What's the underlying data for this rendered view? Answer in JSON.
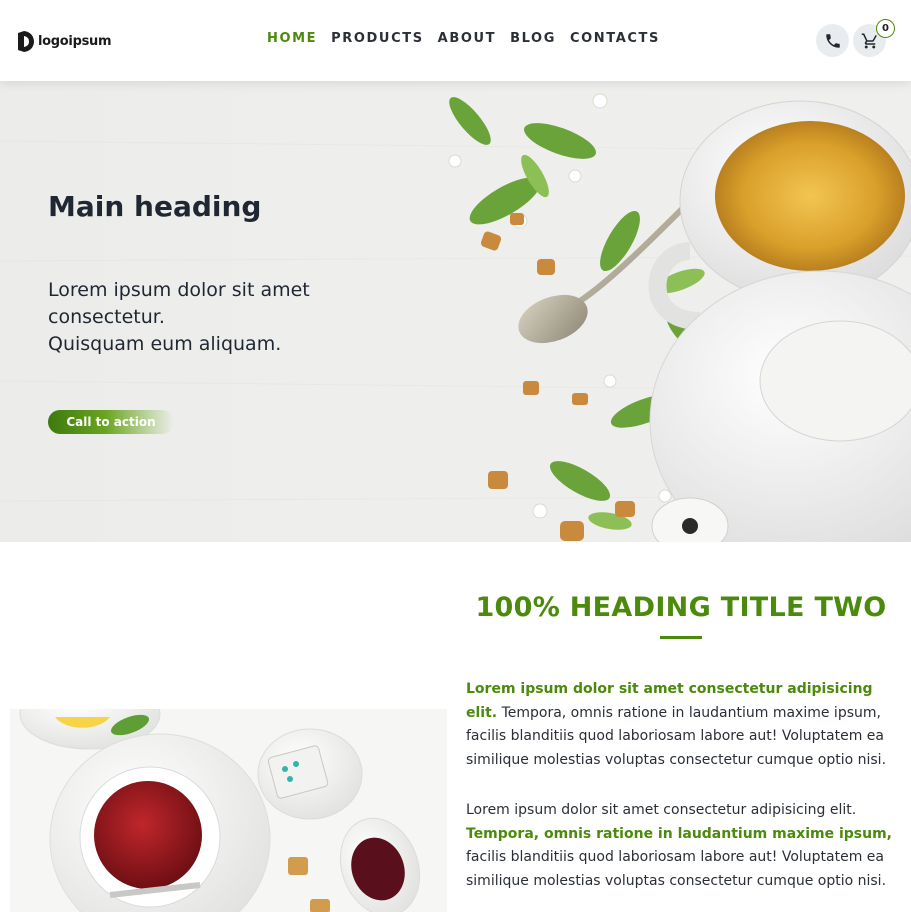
{
  "header": {
    "logo_text": "logoipsum",
    "nav": [
      {
        "label": "HOME",
        "active": true
      },
      {
        "label": "PRODUCTS",
        "active": false
      },
      {
        "label": "ABOUT",
        "active": false
      },
      {
        "label": "BLOG",
        "active": false
      },
      {
        "label": "CONTACTS",
        "active": false
      }
    ],
    "phone_icon": "phone-icon",
    "cart_icon": "cart-icon",
    "cart_count": "0"
  },
  "hero": {
    "title": "Main heading",
    "text_lines": [
      "Lorem ipsum dolor sit amet",
      "consectetur.",
      "Quisquam eum aliquam."
    ],
    "cta_label": "Call to action"
  },
  "section_two": {
    "heading": "100% HEADING TITLE TWO",
    "para1_highlight": "Lorem ipsum dolor sit amet consectetur adipisicing elit.",
    "para1_rest": "Tempora, omnis ratione in laudantium maxime ipsum, facilis blanditiis quod laboriosam labore aut! Voluptatem ea similique molestias voluptas consectetur cumque optio nisi.",
    "para2_start": "Lorem ipsum dolor sit amet consectetur adipisicing elit.",
    "para2_highlight": "Tempora, omnis ratione in laudantium maxime ipsum,",
    "para2_rest": "facilis blanditiis quod laboriosam labore aut! Voluptatem ea similique molestias voluptas consectetur cumque optio nisi."
  },
  "colors": {
    "accent": "#4b8a0c",
    "text_dark": "#1f2733",
    "icon_bg": "#e9ecef"
  }
}
